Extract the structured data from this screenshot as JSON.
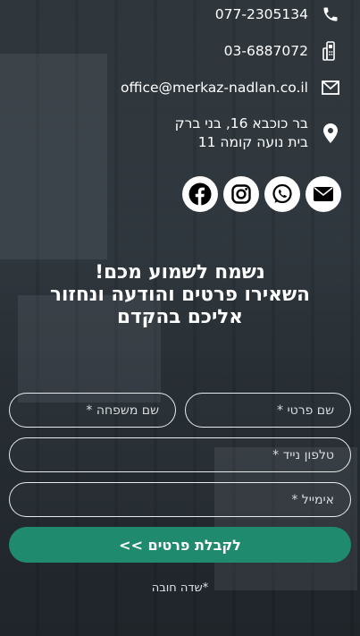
{
  "contact": {
    "phone_main": "077-2305134",
    "phone_office": "03-6887072",
    "email": "office@merkaz-nadlan.co.il",
    "address_line1": "בר כוכבא 16, בני ברק",
    "address_line2": "בית נועה קומה 11",
    "icons": [
      "phone-icon",
      "office-phone-icon",
      "envelope-icon",
      "map-pin-icon"
    ]
  },
  "social": {
    "icons": [
      "envelope-icon",
      "whatsapp-icon",
      "instagram-icon",
      "facebook-icon"
    ]
  },
  "headline": {
    "line1": "נשמח לשמוע מכם!",
    "line2": "השאירו פרטים והודעה ונחזור",
    "line3": "אליכם בהקדם"
  },
  "form": {
    "first_name_placeholder": "שם פרטי *",
    "last_name_placeholder": "שם משפחה *",
    "mobile_placeholder": "טלפון נייד *",
    "email_placeholder": "אימייל *",
    "submit_label": "לקבלת פרטים >>",
    "required_note": "*שדה חובה"
  },
  "colors": {
    "accent": "#1f8a6e",
    "text": "#ffffff"
  }
}
